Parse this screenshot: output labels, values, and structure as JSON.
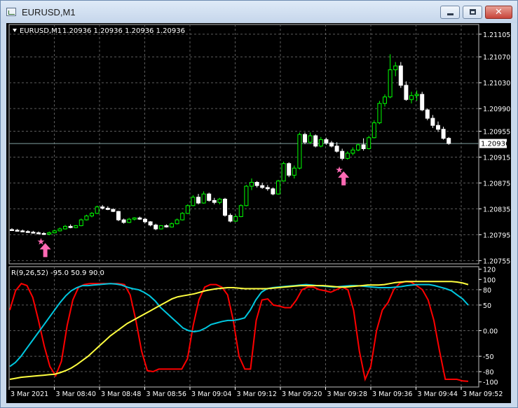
{
  "window": {
    "title": "EURUSD,M1",
    "controls": {
      "minimize": "minimize",
      "maximize": "maximize",
      "close": "close"
    }
  },
  "chart_header": {
    "symbol": "EURUSD,M1",
    "ohlc": "1.20936 1.20936 1.20936 1.20936"
  },
  "colors": {
    "background": "#000000",
    "grid": "#5c5c5c",
    "axis_text": "#ffffff",
    "candle_bull": "#00ff00",
    "candle_bear": "#ffffff",
    "signal_arrow": "#ff69b4",
    "bid_line": "#7f9f9f",
    "price_label_bg": "#ffffff",
    "indicator_red": "#ff0000",
    "indicator_cyan": "#00c8e0",
    "indicator_yellow": "#ffff40"
  },
  "icons": {
    "collapse": "triangle-down-icon",
    "signal": "buy-arrow-star-icon"
  },
  "chart_data": [
    {
      "type": "candlestick",
      "title": "EURUSD,M1",
      "ylim": [
        1.2075,
        1.2112
      ],
      "y_ticks": [
        "1.21105",
        "1.21070",
        "1.21030",
        "1.20990",
        "1.20955",
        "1.20915",
        "1.20875",
        "1.20835",
        "1.20795",
        "1.20755"
      ],
      "current_price": "1.20936",
      "grid": true,
      "candles": [
        {
          "o": 1.20803,
          "h": 1.20805,
          "l": 1.20801,
          "c": 1.20802
        },
        {
          "o": 1.20802,
          "h": 1.20804,
          "l": 1.208,
          "c": 1.20801
        },
        {
          "o": 1.20801,
          "h": 1.20803,
          "l": 1.20799,
          "c": 1.208
        },
        {
          "o": 1.208,
          "h": 1.20802,
          "l": 1.20798,
          "c": 1.20799
        },
        {
          "o": 1.20799,
          "h": 1.20801,
          "l": 1.20797,
          "c": 1.20798
        },
        {
          "o": 1.20798,
          "h": 1.208,
          "l": 1.20796,
          "c": 1.20797
        },
        {
          "o": 1.20797,
          "h": 1.20799,
          "l": 1.20795,
          "c": 1.20796
        },
        {
          "o": 1.20796,
          "h": 1.208,
          "l": 1.20794,
          "c": 1.20798
        },
        {
          "o": 1.20798,
          "h": 1.20803,
          "l": 1.20797,
          "c": 1.20801
        },
        {
          "o": 1.20801,
          "h": 1.20806,
          "l": 1.208,
          "c": 1.20804
        },
        {
          "o": 1.20804,
          "h": 1.2081,
          "l": 1.20803,
          "c": 1.20808
        },
        {
          "o": 1.20808,
          "h": 1.20811,
          "l": 1.20805,
          "c": 1.20806
        },
        {
          "o": 1.20806,
          "h": 1.2081,
          "l": 1.20805,
          "c": 1.20809
        },
        {
          "o": 1.20809,
          "h": 1.2082,
          "l": 1.20808,
          "c": 1.20818
        },
        {
          "o": 1.20818,
          "h": 1.20826,
          "l": 1.20817,
          "c": 1.20824
        },
        {
          "o": 1.20824,
          "h": 1.2083,
          "l": 1.20822,
          "c": 1.20828
        },
        {
          "o": 1.20828,
          "h": 1.2084,
          "l": 1.20827,
          "c": 1.20838
        },
        {
          "o": 1.20838,
          "h": 1.20841,
          "l": 1.20834,
          "c": 1.20836
        },
        {
          "o": 1.20836,
          "h": 1.20839,
          "l": 1.20833,
          "c": 1.20834
        },
        {
          "o": 1.20834,
          "h": 1.20836,
          "l": 1.2083,
          "c": 1.20831
        },
        {
          "o": 1.20831,
          "h": 1.20832,
          "l": 1.20816,
          "c": 1.20818
        },
        {
          "o": 1.20818,
          "h": 1.2082,
          "l": 1.20812,
          "c": 1.20814
        },
        {
          "o": 1.20814,
          "h": 1.20821,
          "l": 1.20813,
          "c": 1.20819
        },
        {
          "o": 1.20819,
          "h": 1.20822,
          "l": 1.20817,
          "c": 1.20821
        },
        {
          "o": 1.20821,
          "h": 1.20823,
          "l": 1.20818,
          "c": 1.20819
        },
        {
          "o": 1.20819,
          "h": 1.20821,
          "l": 1.20813,
          "c": 1.20815
        },
        {
          "o": 1.20815,
          "h": 1.20816,
          "l": 1.20808,
          "c": 1.2081
        },
        {
          "o": 1.2081,
          "h": 1.20812,
          "l": 1.20802,
          "c": 1.20804
        },
        {
          "o": 1.20804,
          "h": 1.2081,
          "l": 1.20803,
          "c": 1.20809
        },
        {
          "o": 1.20809,
          "h": 1.20811,
          "l": 1.20806,
          "c": 1.20807
        },
        {
          "o": 1.20807,
          "h": 1.20814,
          "l": 1.20806,
          "c": 1.20812
        },
        {
          "o": 1.20812,
          "h": 1.2082,
          "l": 1.20811,
          "c": 1.20818
        },
        {
          "o": 1.20818,
          "h": 1.2083,
          "l": 1.20817,
          "c": 1.20828
        },
        {
          "o": 1.20828,
          "h": 1.20842,
          "l": 1.20827,
          "c": 1.2084
        },
        {
          "o": 1.2084,
          "h": 1.20856,
          "l": 1.20839,
          "c": 1.20853
        },
        {
          "o": 1.20853,
          "h": 1.20858,
          "l": 1.20842,
          "c": 1.20844
        },
        {
          "o": 1.20844,
          "h": 1.20862,
          "l": 1.20843,
          "c": 1.20858
        },
        {
          "o": 1.20858,
          "h": 1.2086,
          "l": 1.20846,
          "c": 1.20848
        },
        {
          "o": 1.20848,
          "h": 1.20852,
          "l": 1.20842,
          "c": 1.20845
        },
        {
          "o": 1.20845,
          "h": 1.20852,
          "l": 1.20842,
          "c": 1.2085
        },
        {
          "o": 1.2085,
          "h": 1.20852,
          "l": 1.20823,
          "c": 1.20825
        },
        {
          "o": 1.20825,
          "h": 1.20828,
          "l": 1.20814,
          "c": 1.20816
        },
        {
          "o": 1.20816,
          "h": 1.20826,
          "l": 1.20815,
          "c": 1.20823
        },
        {
          "o": 1.20823,
          "h": 1.20842,
          "l": 1.20822,
          "c": 1.2084
        },
        {
          "o": 1.2084,
          "h": 1.20872,
          "l": 1.20839,
          "c": 1.2087
        },
        {
          "o": 1.2087,
          "h": 1.20882,
          "l": 1.20864,
          "c": 1.20876
        },
        {
          "o": 1.20876,
          "h": 1.20878,
          "l": 1.20868,
          "c": 1.20871
        },
        {
          "o": 1.20871,
          "h": 1.20875,
          "l": 1.20866,
          "c": 1.20868
        },
        {
          "o": 1.20868,
          "h": 1.20872,
          "l": 1.20863,
          "c": 1.20866
        },
        {
          "o": 1.20866,
          "h": 1.20868,
          "l": 1.20856,
          "c": 1.20858
        },
        {
          "o": 1.20858,
          "h": 1.2088,
          "l": 1.20857,
          "c": 1.20878
        },
        {
          "o": 1.20878,
          "h": 1.20908,
          "l": 1.20877,
          "c": 1.20905
        },
        {
          "o": 1.20905,
          "h": 1.20907,
          "l": 1.20884,
          "c": 1.20887
        },
        {
          "o": 1.20887,
          "h": 1.20902,
          "l": 1.20882,
          "c": 1.20898
        },
        {
          "o": 1.20898,
          "h": 1.20953,
          "l": 1.20896,
          "c": 1.2095
        },
        {
          "o": 1.2095,
          "h": 1.20953,
          "l": 1.20935,
          "c": 1.20938
        },
        {
          "o": 1.20938,
          "h": 1.20953,
          "l": 1.20935,
          "c": 1.20948
        },
        {
          "o": 1.20948,
          "h": 1.2095,
          "l": 1.2093,
          "c": 1.20932
        },
        {
          "o": 1.20932,
          "h": 1.20946,
          "l": 1.2093,
          "c": 1.20942
        },
        {
          "o": 1.20942,
          "h": 1.20945,
          "l": 1.20934,
          "c": 1.20937
        },
        {
          "o": 1.20937,
          "h": 1.2094,
          "l": 1.2093,
          "c": 1.20932
        },
        {
          "o": 1.20932,
          "h": 1.20938,
          "l": 1.20922,
          "c": 1.20924
        },
        {
          "o": 1.20924,
          "h": 1.20928,
          "l": 1.2091,
          "c": 1.20913
        },
        {
          "o": 1.20913,
          "h": 1.20924,
          "l": 1.20911,
          "c": 1.20921
        },
        {
          "o": 1.20921,
          "h": 1.2093,
          "l": 1.20918,
          "c": 1.20926
        },
        {
          "o": 1.20926,
          "h": 1.20936,
          "l": 1.20924,
          "c": 1.20934
        },
        {
          "o": 1.20934,
          "h": 1.20944,
          "l": 1.20925,
          "c": 1.20928
        },
        {
          "o": 1.20928,
          "h": 1.20948,
          "l": 1.20927,
          "c": 1.20945
        },
        {
          "o": 1.20945,
          "h": 1.20972,
          "l": 1.20944,
          "c": 1.20968
        },
        {
          "o": 1.20968,
          "h": 1.21002,
          "l": 1.20966,
          "c": 1.20998
        },
        {
          "o": 1.20998,
          "h": 1.21012,
          "l": 1.20993,
          "c": 1.21008
        },
        {
          "o": 1.21008,
          "h": 1.21074,
          "l": 1.21006,
          "c": 1.2105
        },
        {
          "o": 1.2105,
          "h": 1.21062,
          "l": 1.2104,
          "c": 1.21056
        },
        {
          "o": 1.21056,
          "h": 1.21062,
          "l": 1.21022,
          "c": 1.21026
        },
        {
          "o": 1.21026,
          "h": 1.21032,
          "l": 1.21002,
          "c": 1.21004
        },
        {
          "o": 1.21004,
          "h": 1.21016,
          "l": 1.20998,
          "c": 1.2101
        },
        {
          "o": 1.2101,
          "h": 1.21018,
          "l": 1.21002,
          "c": 1.21012
        },
        {
          "o": 1.21012,
          "h": 1.21016,
          "l": 1.20986,
          "c": 1.20988
        },
        {
          "o": 1.20988,
          "h": 1.2099,
          "l": 1.20972,
          "c": 1.20975
        },
        {
          "o": 1.20975,
          "h": 1.2098,
          "l": 1.2096,
          "c": 1.20964
        },
        {
          "o": 1.20964,
          "h": 1.2097,
          "l": 1.20954,
          "c": 1.20958
        },
        {
          "o": 1.20958,
          "h": 1.20962,
          "l": 1.20942,
          "c": 1.20944
        },
        {
          "o": 1.20944,
          "h": 1.20946,
          "l": 1.20934,
          "c": 1.20936
        }
      ],
      "signals": [
        {
          "candle": 6,
          "price": 1.20782
        },
        {
          "candle": 62,
          "price": 1.20893
        }
      ]
    },
    {
      "type": "line",
      "title": "R(9,26,52) -95.0 50.9 90.0",
      "ylim": [
        -110,
        125
      ],
      "y_ticks": [
        "120",
        "100",
        "80",
        "50",
        "0.00",
        "-50",
        "-80",
        "-100"
      ],
      "x_labels": [
        "3 Mar 2021",
        "3 Mar 08:40",
        "3 Mar 08:48",
        "3 Mar 08:56",
        "3 Mar 09:04",
        "3 Mar 09:12",
        "3 Mar 09:20",
        "3 Mar 09:28",
        "3 Mar 09:36",
        "3 Mar 09:44",
        "3 Mar 09:52"
      ],
      "grid": true,
      "series": [
        {
          "color": "#ff0000",
          "values": [
            40,
            78,
            92,
            88,
            65,
            20,
            -30,
            -70,
            -88,
            -60,
            10,
            60,
            85,
            90,
            92,
            92,
            92,
            92,
            92,
            92,
            90,
            70,
            20,
            -40,
            -78,
            -80,
            -75,
            -75,
            -75,
            -75,
            -75,
            -55,
            10,
            60,
            85,
            90,
            90,
            85,
            70,
            20,
            -50,
            -75,
            -75,
            20,
            60,
            62,
            50,
            48,
            45,
            45,
            60,
            80,
            85,
            85,
            80,
            78,
            75,
            80,
            85,
            80,
            40,
            -40,
            -95,
            -70,
            0,
            40,
            55,
            80,
            92,
            96,
            95,
            88,
            80,
            60,
            20,
            -40,
            -95,
            -95,
            -95,
            -98,
            -99
          ]
        },
        {
          "color": "#00c8e0",
          "values": [
            -70,
            -62,
            -50,
            -35,
            -20,
            -5,
            10,
            25,
            40,
            55,
            68,
            78,
            84,
            88,
            88,
            89,
            90,
            91,
            92,
            91,
            89,
            85,
            82,
            80,
            75,
            68,
            58,
            45,
            35,
            25,
            15,
            5,
            0,
            -2,
            0,
            5,
            12,
            15,
            18,
            20,
            20,
            22,
            25,
            40,
            60,
            75,
            82,
            84,
            85,
            86,
            87,
            88,
            89,
            90,
            89,
            88,
            87,
            86,
            85,
            86,
            87,
            88,
            88,
            87,
            86,
            85,
            84,
            84,
            84,
            85,
            86,
            88,
            89,
            90,
            90,
            90,
            88,
            85,
            82,
            78,
            70,
            62,
            50
          ]
        },
        {
          "color": "#ffff40",
          "values": [
            -95,
            -93,
            -91,
            -90,
            -89,
            -88,
            -87,
            -86,
            -85,
            -82,
            -78,
            -73,
            -66,
            -58,
            -50,
            -40,
            -30,
            -20,
            -10,
            -2,
            6,
            14,
            20,
            26,
            32,
            38,
            44,
            50,
            56,
            62,
            66,
            68,
            70,
            72,
            75,
            78,
            80,
            82,
            83,
            84,
            84,
            83,
            82,
            82,
            82,
            82,
            82,
            83,
            84,
            85,
            86,
            87,
            88,
            88,
            88,
            88,
            88,
            87,
            86,
            85,
            85,
            86,
            87,
            88,
            89,
            89,
            89,
            90,
            92,
            94,
            95,
            96,
            96,
            96,
            96,
            96,
            96,
            96,
            96,
            96,
            95,
            93,
            90
          ]
        }
      ]
    }
  ]
}
